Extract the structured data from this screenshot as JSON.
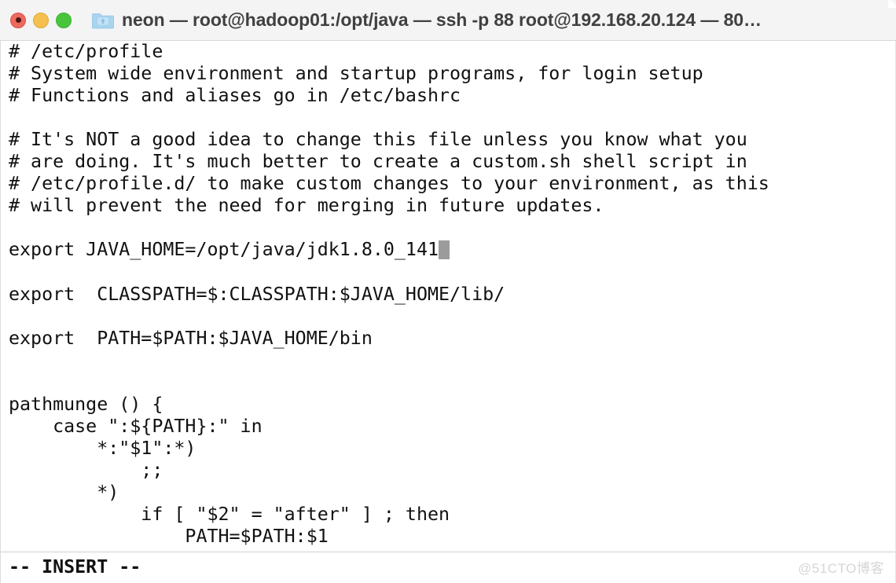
{
  "window": {
    "title": "neon — root@hadoop01:/opt/java — ssh -p 88 root@192.168.20.124 — 80…",
    "folder_icon": "folder-icon",
    "traffic_lights": {
      "close_label": "close",
      "minimize_label": "minimize",
      "zoom_label": "zoom",
      "close_color": "#ec6a5e",
      "minimize_color": "#f5c04f",
      "zoom_color": "#49c53d"
    }
  },
  "terminal": {
    "cursor": {
      "line_index": 9,
      "column": 39,
      "color": "#9b9b9b"
    },
    "lines": [
      "# /etc/profile",
      "# System wide environment and startup programs, for login setup",
      "# Functions and aliases go in /etc/bashrc",
      "",
      "# It's NOT a good idea to change this file unless you know what you",
      "# are doing. It's much better to create a custom.sh shell script in",
      "# /etc/profile.d/ to make custom changes to your environment, as this",
      "# will prevent the need for merging in future updates.",
      "",
      "export JAVA_HOME=/opt/java/jdk1.8.0_141",
      "",
      "export  CLASSPATH=$:CLASSPATH:$JAVA_HOME/lib/",
      "",
      "export  PATH=$PATH:$JAVA_HOME/bin",
      "",
      "",
      "pathmunge () {",
      "    case \":${PATH}:\" in",
      "        *:\"$1\":*)",
      "            ;;",
      "        *)",
      "            if [ \"$2\" = \"after\" ] ; then",
      "                PATH=$PATH:$1"
    ]
  },
  "statusbar": {
    "mode": "-- INSERT --"
  },
  "watermark": {
    "text": "@51CTO博客"
  }
}
